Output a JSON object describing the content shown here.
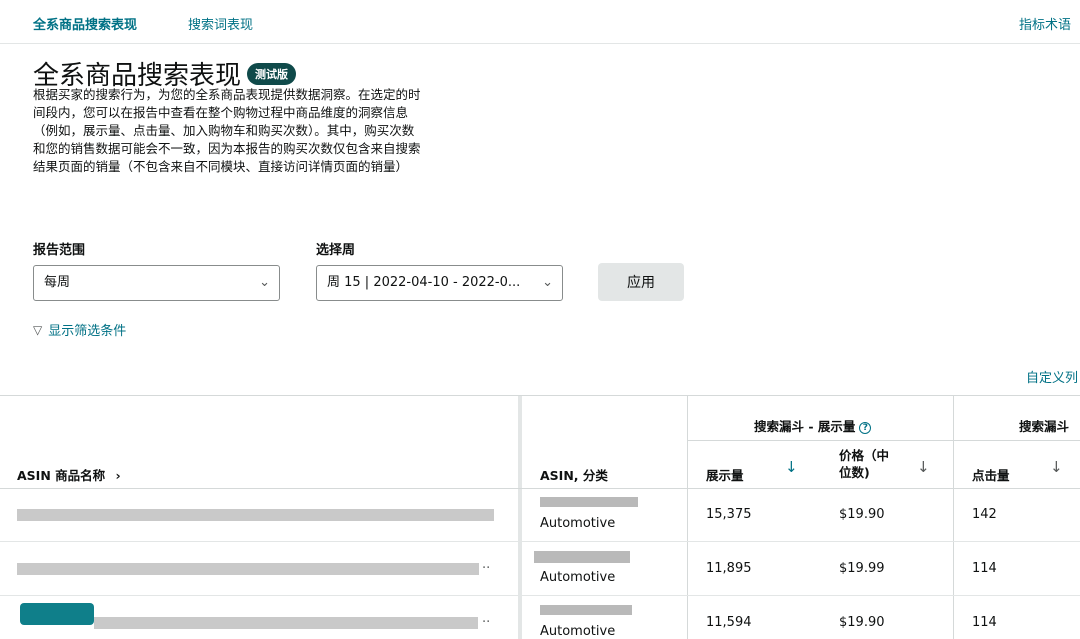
{
  "nav": {
    "tabs": [
      {
        "label": "全系商品搜索表现",
        "active": true
      },
      {
        "label": "搜索词表现",
        "active": false
      }
    ],
    "glossary": "指标术语"
  },
  "header": {
    "title": "全系商品搜索表现",
    "badge": "测试版",
    "description": "根据买家的搜索行为，为您的全系商品表现提供数据洞察。在选定的时间段内，您可以在报告中查看在整个购物过程中商品维度的洞察信息（例如，展示量、点击量、加入购物车和购买次数）。其中，购买次数和您的销售数据可能会不一致，因为本报告的购买次数仅包含来自搜索结果页面的销量（不包含来自不同模块、直接访问详情页面的销量）"
  },
  "controls": {
    "range_label": "报告范围",
    "range_value": "每周",
    "week_label": "选择周",
    "week_value": "周 15 | 2022-04-10 - 2022-0...",
    "apply": "应用",
    "show_filters": "显示筛选条件",
    "customize_columns": "自定义列"
  },
  "table": {
    "col_name": "ASIN 商品名称",
    "col_asin": "ASIN, 分类",
    "group_impressions": "搜索漏斗 - 展示量",
    "group_clicks": "搜索漏斗",
    "col_impressions": "展示量",
    "col_price_line1": "价格（中",
    "col_price_line2": "位数)",
    "col_clicks": "点击量",
    "rows": [
      {
        "category": "Automotive",
        "impressions": "15,375",
        "price": "$19.90",
        "clicks": "142"
      },
      {
        "category": "Automotive",
        "impressions": "11,895",
        "price": "$19.99",
        "clicks": "114"
      },
      {
        "category": "Automotive",
        "impressions": "11,594",
        "price": "$19.90",
        "clicks": "114"
      }
    ]
  },
  "icons": {
    "chevron": "chevron-down-icon",
    "sort": "sort-down-icon",
    "filter": "filter-icon",
    "help": "help-icon"
  },
  "colors": {
    "link": "#007185",
    "badge": "#0f4a4a",
    "button": "#e3e6e6"
  }
}
